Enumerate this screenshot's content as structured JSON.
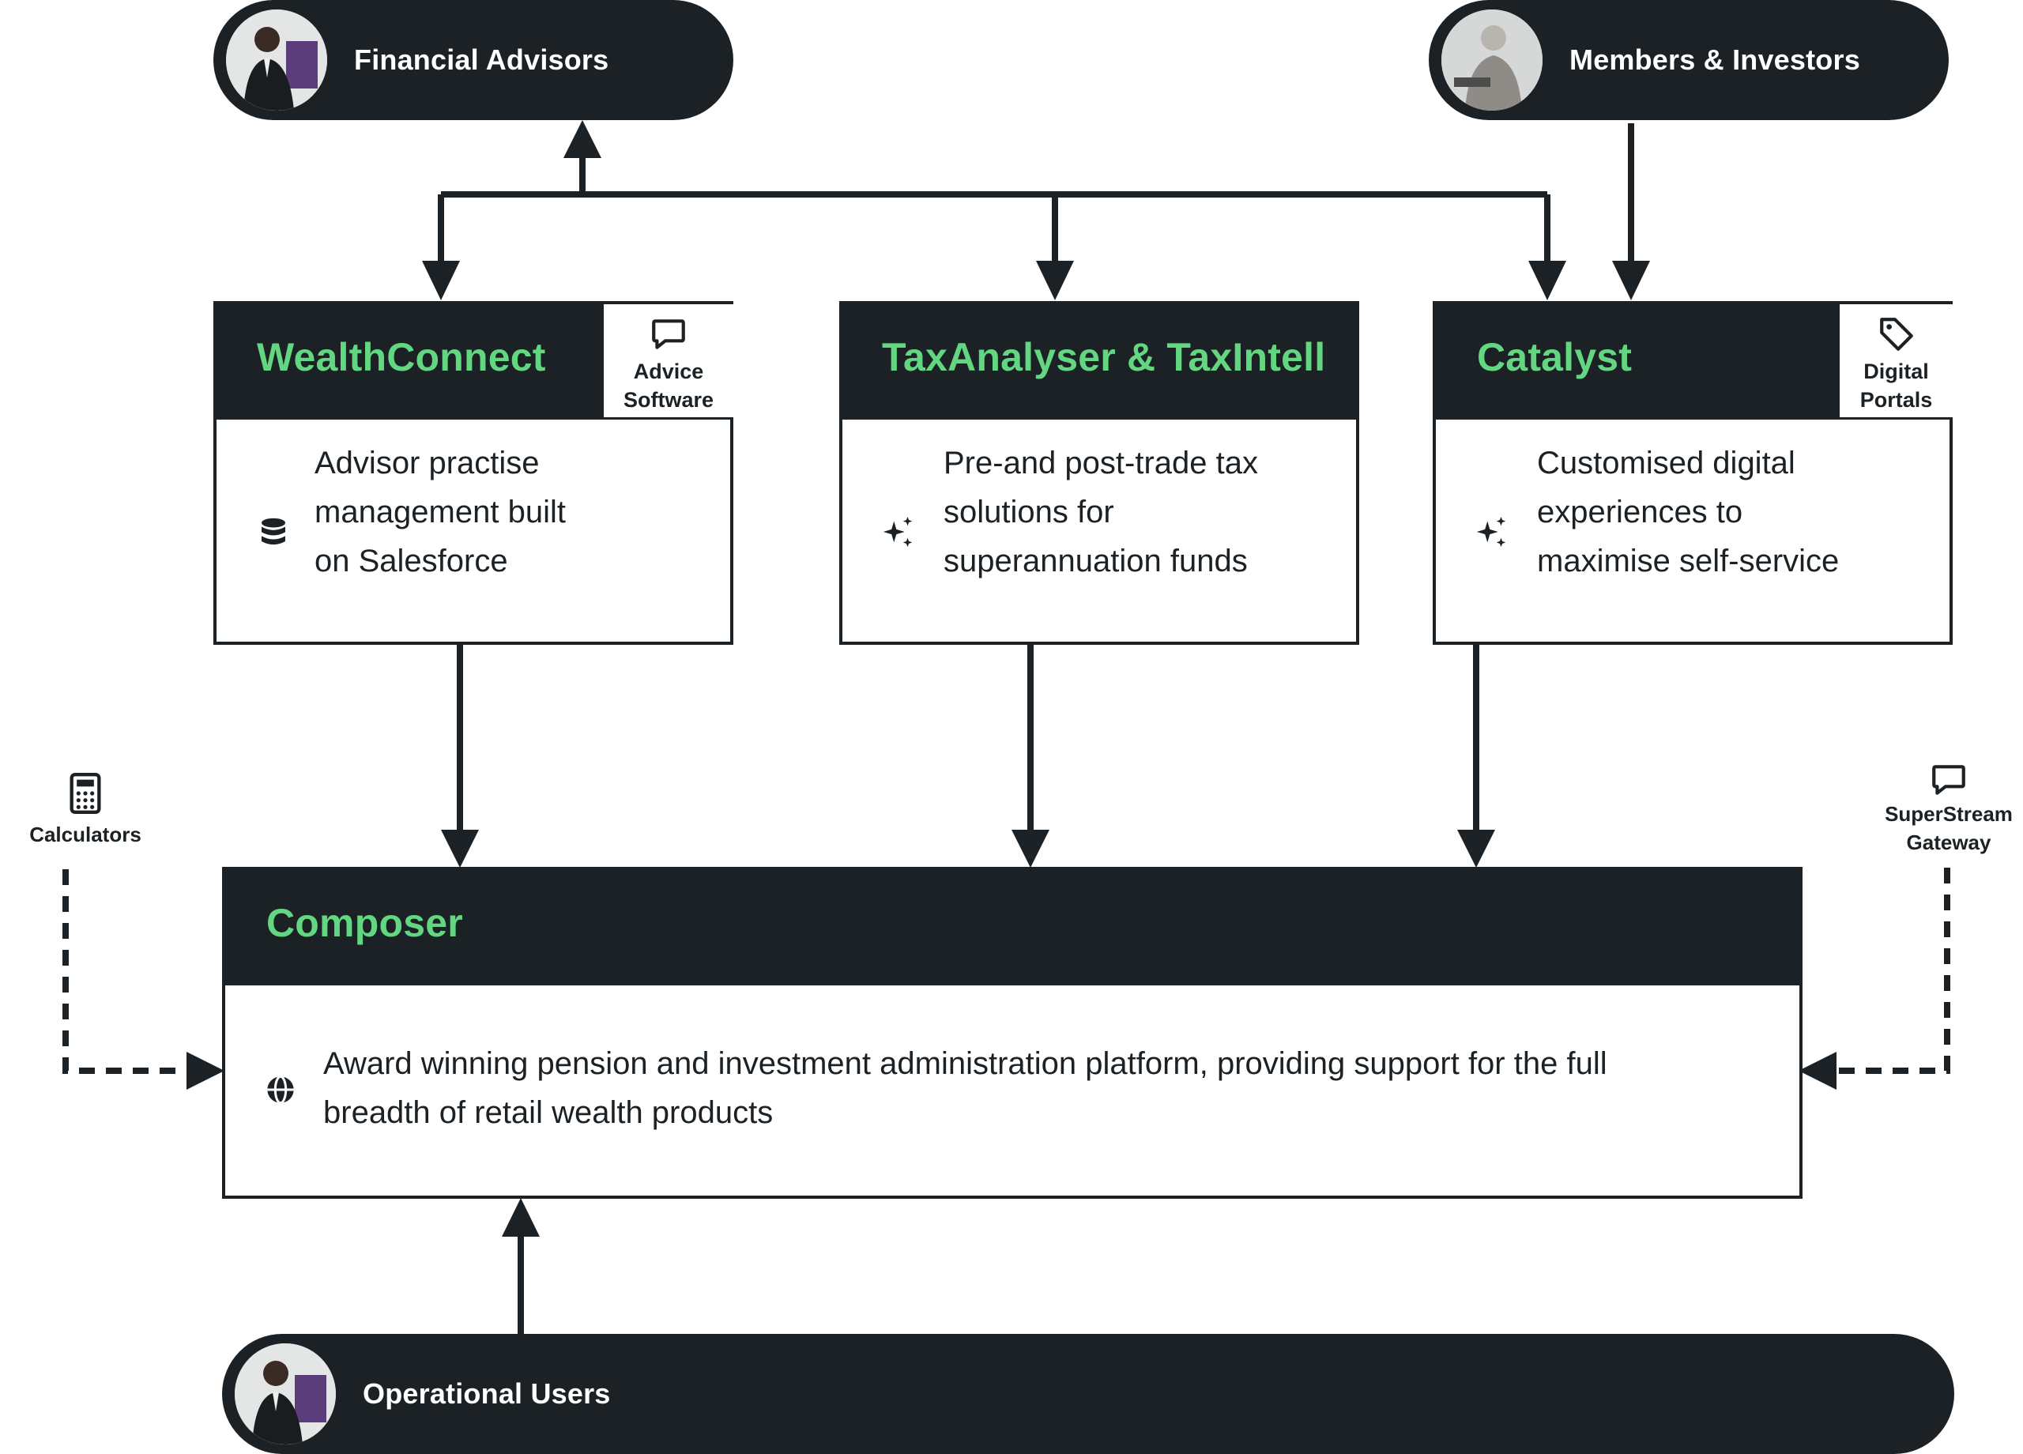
{
  "actors": {
    "financial_advisors": "Financial Advisors",
    "members_investors": "Members & Investors",
    "operational_users": "Operational Users"
  },
  "products": {
    "wealthconnect": {
      "title": "WealthConnect",
      "badge": [
        "Advice",
        "Software"
      ],
      "description": [
        "Advisor practise",
        "management built",
        "on Salesforce"
      ],
      "icon": "database-icon"
    },
    "taxanalyser": {
      "title": "TaxAnalyser & TaxIntell",
      "description": [
        "Pre-and post-trade tax",
        "solutions for",
        "superannuation funds"
      ],
      "icon": "sparkles-icon"
    },
    "catalyst": {
      "title": "Catalyst",
      "badge": [
        "Digital",
        "Portals"
      ],
      "description": [
        "Customised digital",
        "experiences to",
        "maximise self-service"
      ],
      "icon": "sparkles-icon"
    },
    "composer": {
      "title": "Composer",
      "description": [
        "Award winning pension and investment administration platform, providing support for the full",
        "breadth of retail wealth products"
      ],
      "icon": "globe-icon"
    }
  },
  "side_tools": {
    "calculators": "Calculators",
    "superstream": [
      "SuperStream",
      "Gateway"
    ]
  },
  "colors": {
    "dark": "#1b2124",
    "accent_green": "#63d681",
    "background": "#ffffff"
  }
}
